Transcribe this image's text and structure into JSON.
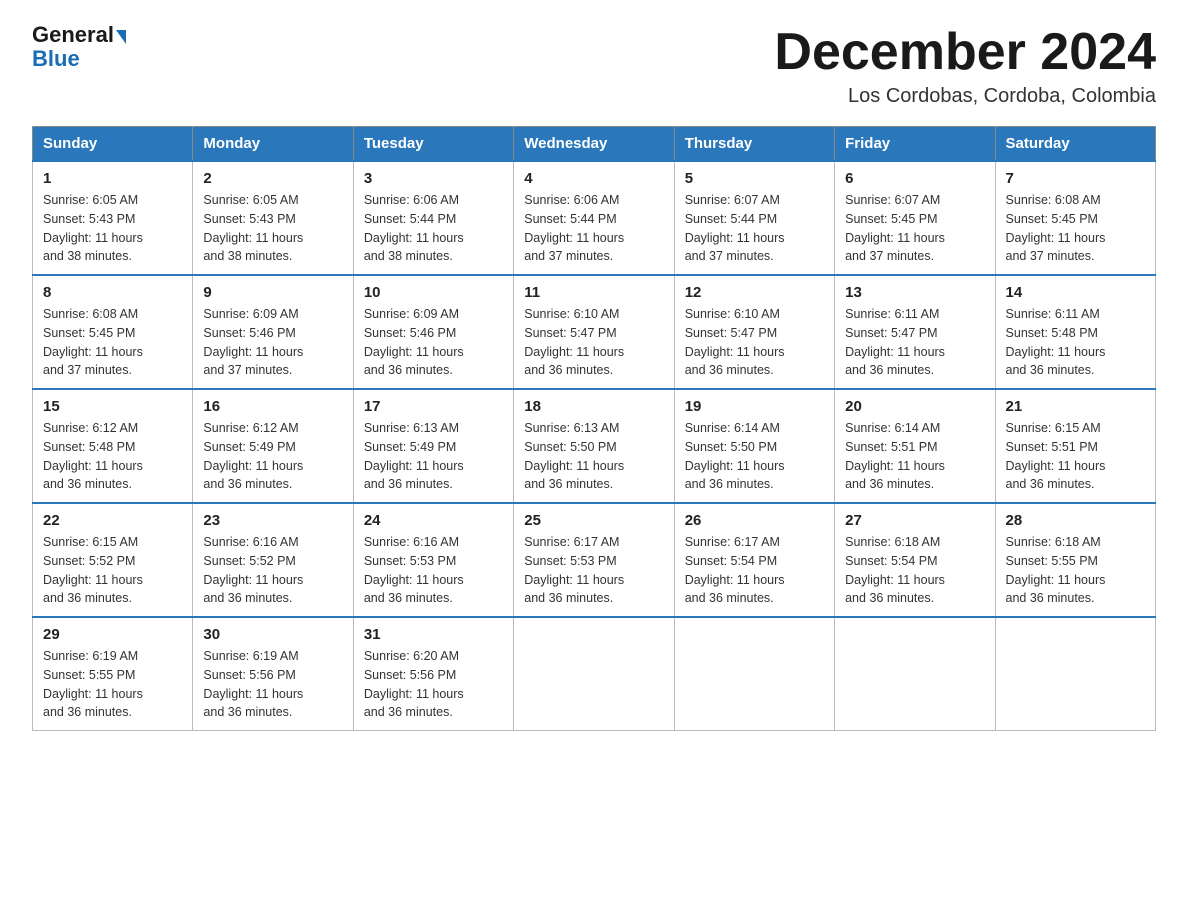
{
  "logo": {
    "general": "General",
    "blue": "Blue"
  },
  "title": "December 2024",
  "subtitle": "Los Cordobas, Cordoba, Colombia",
  "headers": [
    "Sunday",
    "Monday",
    "Tuesday",
    "Wednesday",
    "Thursday",
    "Friday",
    "Saturday"
  ],
  "weeks": [
    [
      {
        "day": "1",
        "sunrise": "6:05 AM",
        "sunset": "5:43 PM",
        "daylight": "11 hours and 38 minutes."
      },
      {
        "day": "2",
        "sunrise": "6:05 AM",
        "sunset": "5:43 PM",
        "daylight": "11 hours and 38 minutes."
      },
      {
        "day": "3",
        "sunrise": "6:06 AM",
        "sunset": "5:44 PM",
        "daylight": "11 hours and 38 minutes."
      },
      {
        "day": "4",
        "sunrise": "6:06 AM",
        "sunset": "5:44 PM",
        "daylight": "11 hours and 37 minutes."
      },
      {
        "day": "5",
        "sunrise": "6:07 AM",
        "sunset": "5:44 PM",
        "daylight": "11 hours and 37 minutes."
      },
      {
        "day": "6",
        "sunrise": "6:07 AM",
        "sunset": "5:45 PM",
        "daylight": "11 hours and 37 minutes."
      },
      {
        "day": "7",
        "sunrise": "6:08 AM",
        "sunset": "5:45 PM",
        "daylight": "11 hours and 37 minutes."
      }
    ],
    [
      {
        "day": "8",
        "sunrise": "6:08 AM",
        "sunset": "5:45 PM",
        "daylight": "11 hours and 37 minutes."
      },
      {
        "day": "9",
        "sunrise": "6:09 AM",
        "sunset": "5:46 PM",
        "daylight": "11 hours and 37 minutes."
      },
      {
        "day": "10",
        "sunrise": "6:09 AM",
        "sunset": "5:46 PM",
        "daylight": "11 hours and 36 minutes."
      },
      {
        "day": "11",
        "sunrise": "6:10 AM",
        "sunset": "5:47 PM",
        "daylight": "11 hours and 36 minutes."
      },
      {
        "day": "12",
        "sunrise": "6:10 AM",
        "sunset": "5:47 PM",
        "daylight": "11 hours and 36 minutes."
      },
      {
        "day": "13",
        "sunrise": "6:11 AM",
        "sunset": "5:47 PM",
        "daylight": "11 hours and 36 minutes."
      },
      {
        "day": "14",
        "sunrise": "6:11 AM",
        "sunset": "5:48 PM",
        "daylight": "11 hours and 36 minutes."
      }
    ],
    [
      {
        "day": "15",
        "sunrise": "6:12 AM",
        "sunset": "5:48 PM",
        "daylight": "11 hours and 36 minutes."
      },
      {
        "day": "16",
        "sunrise": "6:12 AM",
        "sunset": "5:49 PM",
        "daylight": "11 hours and 36 minutes."
      },
      {
        "day": "17",
        "sunrise": "6:13 AM",
        "sunset": "5:49 PM",
        "daylight": "11 hours and 36 minutes."
      },
      {
        "day": "18",
        "sunrise": "6:13 AM",
        "sunset": "5:50 PM",
        "daylight": "11 hours and 36 minutes."
      },
      {
        "day": "19",
        "sunrise": "6:14 AM",
        "sunset": "5:50 PM",
        "daylight": "11 hours and 36 minutes."
      },
      {
        "day": "20",
        "sunrise": "6:14 AM",
        "sunset": "5:51 PM",
        "daylight": "11 hours and 36 minutes."
      },
      {
        "day": "21",
        "sunrise": "6:15 AM",
        "sunset": "5:51 PM",
        "daylight": "11 hours and 36 minutes."
      }
    ],
    [
      {
        "day": "22",
        "sunrise": "6:15 AM",
        "sunset": "5:52 PM",
        "daylight": "11 hours and 36 minutes."
      },
      {
        "day": "23",
        "sunrise": "6:16 AM",
        "sunset": "5:52 PM",
        "daylight": "11 hours and 36 minutes."
      },
      {
        "day": "24",
        "sunrise": "6:16 AM",
        "sunset": "5:53 PM",
        "daylight": "11 hours and 36 minutes."
      },
      {
        "day": "25",
        "sunrise": "6:17 AM",
        "sunset": "5:53 PM",
        "daylight": "11 hours and 36 minutes."
      },
      {
        "day": "26",
        "sunrise": "6:17 AM",
        "sunset": "5:54 PM",
        "daylight": "11 hours and 36 minutes."
      },
      {
        "day": "27",
        "sunrise": "6:18 AM",
        "sunset": "5:54 PM",
        "daylight": "11 hours and 36 minutes."
      },
      {
        "day": "28",
        "sunrise": "6:18 AM",
        "sunset": "5:55 PM",
        "daylight": "11 hours and 36 minutes."
      }
    ],
    [
      {
        "day": "29",
        "sunrise": "6:19 AM",
        "sunset": "5:55 PM",
        "daylight": "11 hours and 36 minutes."
      },
      {
        "day": "30",
        "sunrise": "6:19 AM",
        "sunset": "5:56 PM",
        "daylight": "11 hours and 36 minutes."
      },
      {
        "day": "31",
        "sunrise": "6:20 AM",
        "sunset": "5:56 PM",
        "daylight": "11 hours and 36 minutes."
      },
      null,
      null,
      null,
      null
    ]
  ],
  "labels": {
    "sunrise": "Sunrise:",
    "sunset": "Sunset:",
    "daylight": "Daylight:"
  }
}
